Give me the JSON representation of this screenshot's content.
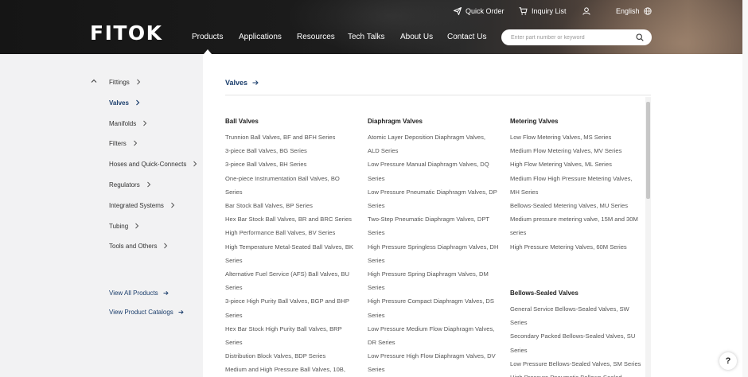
{
  "header": {
    "logo": "FITOK",
    "quick_order": "Quick Order",
    "inquiry_list": "Inquiry List",
    "language": "English",
    "nav": [
      "Products",
      "Applications",
      "Resources",
      "Tech Talks",
      "About Us",
      "Contact Us"
    ],
    "active_nav": "Products",
    "search_placeholder": "Enter part number or keyword"
  },
  "sidebar": {
    "categories": [
      "Fittings",
      "Valves",
      "Manifolds",
      "Filters",
      "Hoses and Quick-Connects",
      "Regulators",
      "Integrated Systems",
      "Tubing",
      "Tools and Others"
    ],
    "active": "Valves",
    "links": [
      "View All Products",
      "View Product Catalogs"
    ]
  },
  "main": {
    "breadcrumb": "Valves",
    "columns": [
      {
        "title": "Ball Valves",
        "lines": [
          "Trunnion Ball Valves, BF and BFH Series",
          "3-piece Ball Valves, BG Series",
          "3-piece Ball Valves, BH Series",
          "One-piece Instrumentation Ball Valves, BO",
          "Series",
          "Bar Stock Ball Valves, BP Series",
          "Hex Bar Stock Ball Valves, BR and BRC Series",
          "High Performance Ball Valves, BV Series",
          "High Temperature Metal-Seated Ball Valves, BK",
          "Series",
          "Alternative Fuel Service (AFS) Ball Valves, BU",
          "Series",
          "3-piece High Purity Ball Valves, BGP and BHP",
          "Series",
          "Hex Bar Stock High Purity Ball Valves, BRP",
          "Series",
          "Distribution Block Valves, BDP Series",
          "Medium and High Pressure Ball Valves, 10B,"
        ]
      },
      {
        "title": "Diaphragm Valves",
        "lines": [
          "Atomic Layer Deposition Diaphragm Valves,",
          "ALD Series",
          "Low Pressure Manual Diaphragm Valves, DQ",
          "Series",
          "Low Pressure Pneumatic Diaphragm Valves, DP",
          "Series",
          "Two-Step Pneumatic Diaphragm Valves, DPT",
          "Series",
          "High Pressure Springless Diaphragm Valves, DH",
          "Series",
          "High Pressure Spring Diaphragm Valves, DM",
          "Series",
          "High Pressure Compact Diaphragm Valves, DS",
          "Series",
          "Low Pressure Medium Flow Diaphragm Valves,",
          "DR Series",
          "Low Pressure High Flow Diaphragm Valves, DV",
          "Series"
        ]
      },
      {
        "title": "Metering Valves",
        "lines": [
          "Low Flow Metering Valves, MS Series",
          "Medium Flow Metering Valves, MV Series",
          "High Flow Metering Valves, ML Series",
          "Medium Flow High Pressure Metering Valves,",
          "MH Series",
          "Bellows-Sealed Metering Valves, MU Series",
          "Medium pressure metering valve, 15M and 30M",
          "series",
          "High Pressure Metering Valves, 60M Series"
        ],
        "title2": "Bellows-Sealed Valves",
        "lines2": [
          "General Service Bellows-Sealed Valves, SW",
          "Series",
          "Secondary Packed Bellows-Sealed Valves, SU",
          "Series",
          "Low Pressure Bellows-Sealed Valves, SM Series",
          "High Pressure Pneumatic Bellows-Sealed"
        ]
      }
    ]
  },
  "help": "?"
}
